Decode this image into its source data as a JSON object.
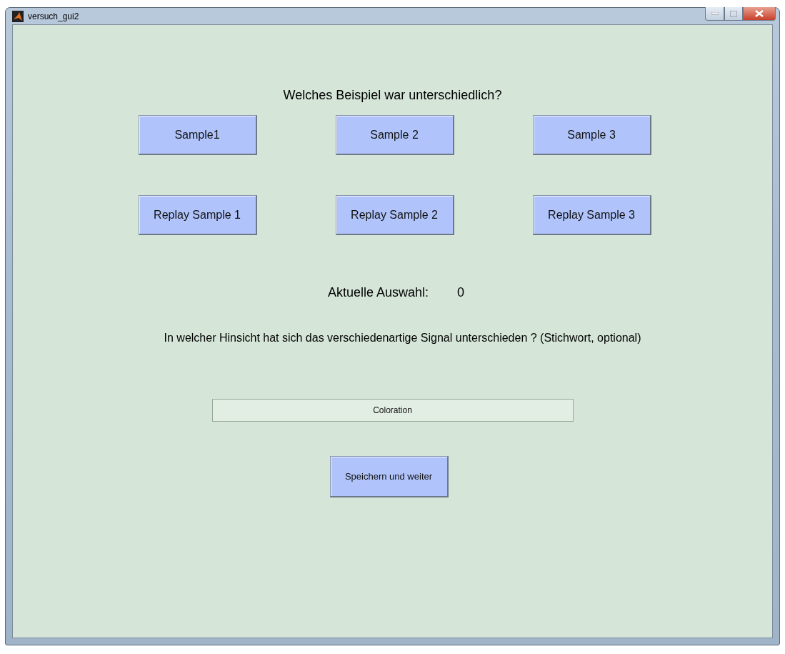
{
  "window": {
    "title": "versuch_gui2"
  },
  "heading": "Welches Beispiel war unterschiedlich?",
  "sample_buttons": [
    "Sample1",
    "Sample 2",
    "Sample 3"
  ],
  "replay_buttons": [
    "Replay Sample 1",
    "Replay Sample 2",
    "Replay Sample 3"
  ],
  "selection": {
    "label": "Aktuelle Auswahl:",
    "value": "0"
  },
  "question": "In welcher Hinsicht hat sich das verschiedenartige Signal unterschieden ? (Stichwort, optional)",
  "answer_field": {
    "value": "Coloration"
  },
  "submit_button": "Speichern und weiter"
}
